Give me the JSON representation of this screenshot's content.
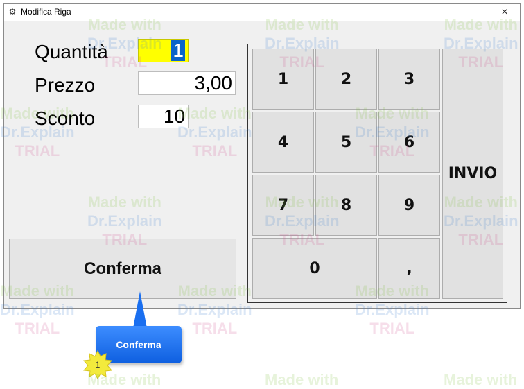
{
  "window": {
    "title": "Modifica Riga",
    "icon": "app-window-icon",
    "close_label": "×"
  },
  "fields": {
    "quantita": {
      "label": "Quantità",
      "value": "1"
    },
    "prezzo": {
      "label": "Prezzo",
      "value": "3,00"
    },
    "sconto": {
      "label": "Sconto",
      "value": "10"
    }
  },
  "buttons": {
    "conferma": "Conferma"
  },
  "keypad": {
    "k1": "1",
    "k2": "2",
    "k3": "3",
    "k4": "4",
    "k5": "5",
    "k6": "6",
    "k7": "7",
    "k8": "8",
    "k9": "9",
    "k0": "0",
    "comma": ",",
    "invio": "INVIO"
  },
  "callout": {
    "label": "Conferma",
    "number": "1"
  },
  "watermark": {
    "line1": "Made with",
    "line2": "Dr.Explain",
    "line3": "TRIAL"
  },
  "colors": {
    "active_field": "#ffff00",
    "selection": "#0a64c8",
    "callout": "#1a6ff0"
  }
}
